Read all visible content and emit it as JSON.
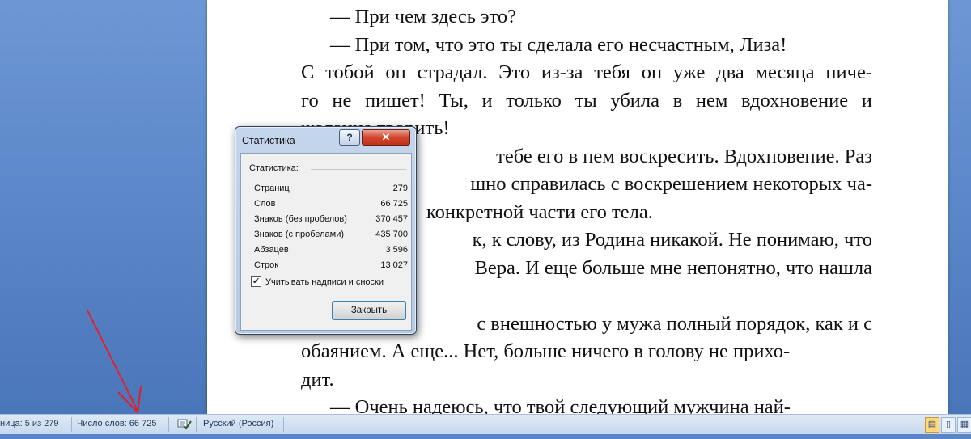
{
  "document": {
    "lines": [
      "— При чем здесь это?",
      "— При том, что это ты сделала его несчастным, Лиза!",
      [
        "С",
        "тобой",
        "он",
        "страдал.",
        "Это",
        "из-за",
        "тебя",
        "он",
        "уже",
        "два",
        "месяца",
        "ниче-"
      ],
      [
        "го",
        "не",
        "пишет!",
        "Ты,",
        "и",
        "только",
        "ты",
        "убила",
        "в",
        "нем",
        "вдохновение",
        "и"
      ],
      "желание творить!",
      "тебе его в нем воскресить. Вдохновение. Раз",
      "шно справилась с воскрешением некоторых ча-",
      "конкретной части его тела.",
      "к, к слову, из Родина никакой. Не понимаю, что",
      "Вера. И еще больше мне непонятно, что нашла",
      "",
      "с внешностью у мужа полный порядок, как и с",
      "обаянием. А еще... Нет, больше ничего в голову не прихо-",
      "дит.",
      "— Очень надеюсь, что твой следующий мужчина най-"
    ]
  },
  "dialog": {
    "title": "Статистика",
    "help_label": "?",
    "close_label": "✕",
    "group_label": "Статистика:",
    "stats": [
      {
        "label": "Страниц",
        "value": "279"
      },
      {
        "label": "Слов",
        "value": "66 725"
      },
      {
        "label": "Знаков (без пробелов)",
        "value": "370 457"
      },
      {
        "label": "Знаков (с пробелами)",
        "value": "435 700"
      },
      {
        "label": "Абзацев",
        "value": "3 596"
      },
      {
        "label": "Строк",
        "value": "13 027"
      }
    ],
    "checkbox_label": "Учитывать надписи и сноски",
    "checkbox_checked": true,
    "ok_label": "Закрыть"
  },
  "statusbar": {
    "page": "ница: 5 из 279",
    "words": "Число слов: 66 725",
    "language": "Русский (Россия)"
  },
  "colors": {
    "annotation_arrow": "#e0202a",
    "workspace": "#5f8acb"
  },
  "icons": [
    "spellcheck-icon",
    "print-layout-icon",
    "full-screen-reading-icon"
  ]
}
